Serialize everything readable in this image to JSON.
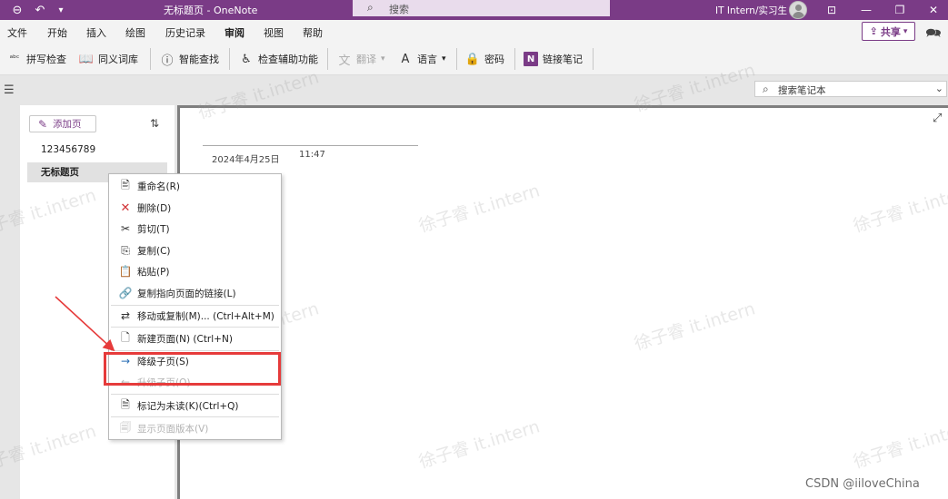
{
  "titlebar": {
    "title": "无标题页 - OneNote",
    "search_placeholder": "搜索",
    "user": "IT Intern/实习生"
  },
  "menu": {
    "tabs": [
      "文件",
      "开始",
      "插入",
      "绘图",
      "历史记录",
      "审阅",
      "视图",
      "帮助"
    ],
    "active": "审阅",
    "share_label": "共享"
  },
  "ribbon": {
    "spellcheck": "拼写检查",
    "thesaurus": "同义词库",
    "smart_lookup": "智能查找",
    "accessibility": "检查辅助功能",
    "translate": "翻译",
    "language": "语言",
    "password": "密码",
    "linked_notes": "链接笔记"
  },
  "notebook_search": {
    "placeholder": "搜索笔记本"
  },
  "pagelist": {
    "add_page": "添加页",
    "pages": [
      {
        "title": "123456789",
        "selected": false
      },
      {
        "title": "无标题页",
        "selected": true
      }
    ]
  },
  "page": {
    "date": "2024年4月25日",
    "time": "11:47"
  },
  "context_menu": {
    "items": [
      {
        "label": "重命名(R)",
        "icon": "rename-icon",
        "enabled": true
      },
      {
        "label": "删除(D)",
        "icon": "delete-x-icon",
        "enabled": true
      },
      {
        "label": "剪切(T)",
        "icon": "scissors-icon",
        "enabled": true
      },
      {
        "label": "复制(C)",
        "icon": "copy-icon",
        "enabled": true
      },
      {
        "label": "粘贴(P)",
        "icon": "paste-icon",
        "enabled": true
      },
      {
        "label": "复制指向页面的链接(L)",
        "icon": "link-page-icon",
        "enabled": true
      },
      {
        "label": "移动或复制(M)...  (Ctrl+Alt+M)",
        "icon": "move-copy-icon",
        "enabled": true
      },
      {
        "label": "新建页面(N)  (Ctrl+N)",
        "icon": "new-page-icon",
        "enabled": true
      },
      {
        "label": "降级子页(S)",
        "icon": "demote-arrow-icon",
        "enabled": true
      },
      {
        "label": "升级子页(O)",
        "icon": "promote-arrow-icon",
        "enabled": false
      },
      {
        "label": "标记为未读(K)(Ctrl+Q)",
        "icon": "mark-unread-icon",
        "enabled": true
      },
      {
        "label": "显示页面版本(V)",
        "icon": "page-versions-icon",
        "enabled": false
      }
    ]
  },
  "watermark": {
    "text": "徐子睿 it.intern",
    "footer": "CSDN @iiloveChina"
  },
  "colors": {
    "brand": "#7a3b86",
    "highlight": "#e63b3b",
    "delete": "#d13438"
  }
}
